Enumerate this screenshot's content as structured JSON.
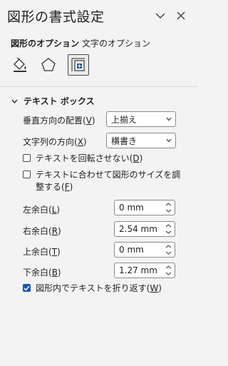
{
  "pane": {
    "title": "図形の書式設定",
    "collapse_icon": "chevron-down-icon",
    "close_icon": "close-icon"
  },
  "tabs": [
    {
      "label": "図形のオプション",
      "active": true
    },
    {
      "label": "文字のオプション",
      "active": false
    }
  ],
  "category_icons": [
    {
      "name": "fill-line-icon",
      "selected": false
    },
    {
      "name": "effects-pentagon-icon",
      "selected": false
    },
    {
      "name": "size-properties-icon",
      "selected": true
    }
  ],
  "section": {
    "title": "テキスト ボックス",
    "expanded": true
  },
  "vertical_alignment": {
    "label_pre": "垂直方向の配置(",
    "label_key": "V",
    "label_post": ")",
    "value": "上揃え"
  },
  "text_direction": {
    "label_pre": "文字列の方向(",
    "label_key": "X",
    "label_post": ")",
    "value": "横書き"
  },
  "no_rotate": {
    "label_pre": "テキストを回転させない(",
    "label_key": "D",
    "label_post": ")",
    "checked": false
  },
  "autofit": {
    "label_pre": "テキストに合わせて図形のサイズを調整する(",
    "label_key": "F",
    "label_post": ")",
    "checked": false
  },
  "margins": [
    {
      "label_pre": "左余白(",
      "label_key": "L",
      "label_post": ")",
      "value": "0 mm"
    },
    {
      "label_pre": "右余白(",
      "label_key": "R",
      "label_post": ")",
      "value": "2.54 mm"
    },
    {
      "label_pre": "上余白(",
      "label_key": "T",
      "label_post": ")",
      "value": "0 mm"
    },
    {
      "label_pre": "下余白(",
      "label_key": "B",
      "label_post": ")",
      "value": "1.27 mm"
    }
  ],
  "wrap_text": {
    "label_pre": "図形内でテキストを折り返す(",
    "label_key": "W",
    "label_post": ")",
    "checked": true
  },
  "colors": {
    "accent": "#1a56a8",
    "background": "#f3f3f3"
  }
}
